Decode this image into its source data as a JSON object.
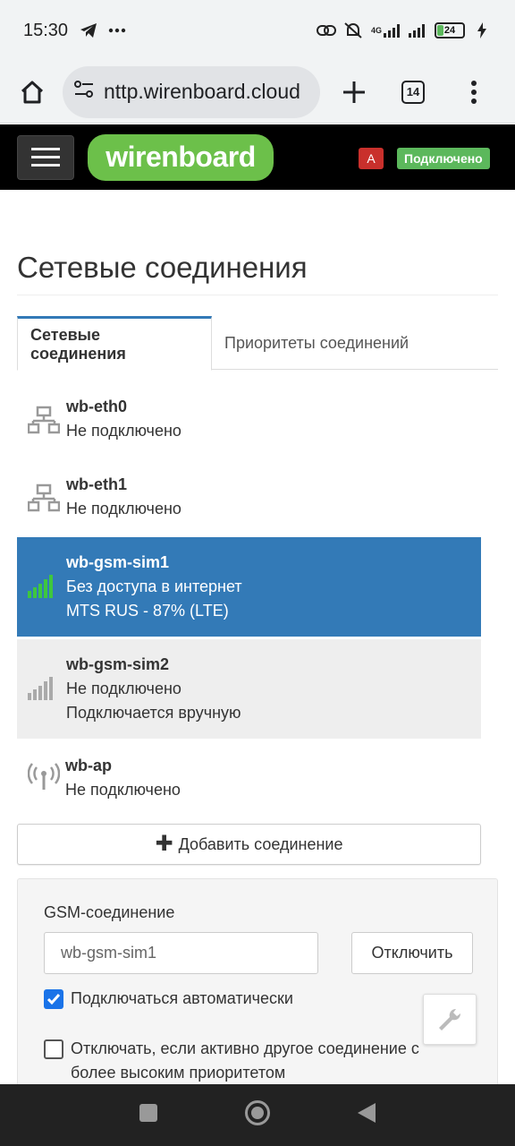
{
  "status_bar": {
    "time": "15:30",
    "left_icons": [
      "telegram-icon",
      "more-dots-icon"
    ],
    "right_icons": [
      "link-icon",
      "mute-icon",
      "4g-signal-icon",
      "signal-icon"
    ],
    "battery_level": "24",
    "battery_fraction": 0.24,
    "network_label": "4G"
  },
  "browser": {
    "url": "nttp.wirenboard.cloud",
    "tab_count": "14",
    "icons": [
      "home-icon",
      "site-settings-icon",
      "new-tab-icon",
      "menu-icon"
    ]
  },
  "app_header": {
    "logo_text": "wirenboard",
    "alert_badge": "A",
    "status_badge": "Подключено",
    "colors": {
      "logo": "#6cc04a",
      "alert": "#c9302c",
      "status": "#5cb85c"
    }
  },
  "page": {
    "title": "Сетевые соединения",
    "tabs": [
      {
        "label": "Сетевые соединения",
        "active": true
      },
      {
        "label": "Приоритеты соединений",
        "active": false
      }
    ]
  },
  "connections": [
    {
      "name": "wb-eth0",
      "status": "Не подключено",
      "icon": "ethernet-icon"
    },
    {
      "name": "wb-eth1",
      "status": "Не подключено",
      "icon": "ethernet-icon"
    },
    {
      "name": "wb-gsm-sim1",
      "status": "Без доступа в интернет",
      "detail": "MTS RUS - 87% (LTE)",
      "icon": "signal-bars-icon",
      "selected": true
    },
    {
      "name": "wb-gsm-sim2",
      "status": "Не подключено",
      "detail": "Подключается вручную",
      "icon": "signal-bars-icon"
    },
    {
      "name": "wb-ap",
      "status": "Не подключено",
      "icon": "wifi-antenna-icon"
    }
  ],
  "add_button": "Добавить соединение",
  "panel": {
    "label": "GSM-соединение",
    "input_value": "wb-gsm-sim1",
    "disconnect_button": "Отключить",
    "auto_connect_label": "Подключаться автоматически",
    "auto_connect_checked": true,
    "disable_if_other_label_line1": "Отключать, если активно другое соединение с",
    "disable_if_other_label_line2": "более высоким приоритетом",
    "disable_if_other_checked": false
  },
  "nav_bar": {
    "icons": [
      "recents-icon",
      "home-circle-icon",
      "back-icon"
    ]
  }
}
